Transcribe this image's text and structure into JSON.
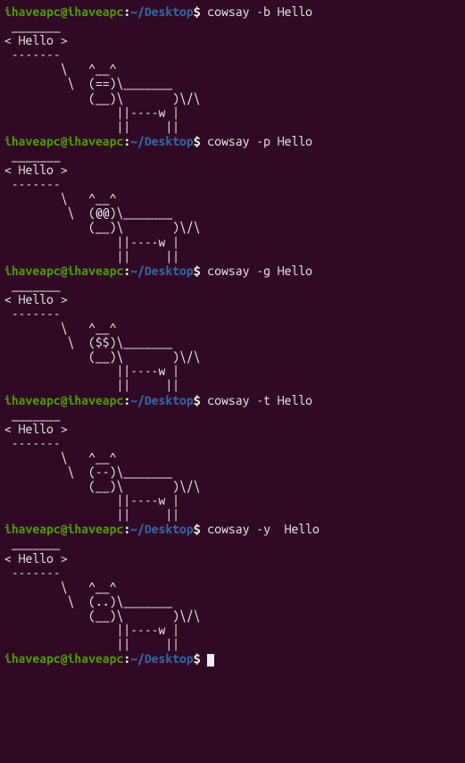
{
  "prompt": {
    "user": "ihaveapc",
    "at": "@",
    "host": "ihaveapc",
    "colon": ":",
    "path": "~/Desktop",
    "dollar": "$"
  },
  "blocks": [
    {
      "cmd": " cowsay -b Hello",
      "output": " _______\n< Hello >\n -------\n        \\   ^__^\n         \\  (==)\\_______\n            (__)\\       )\\/\\\n                ||----w |\n                ||     ||"
    },
    {
      "cmd": " cowsay -p Hello",
      "output": " _______\n< Hello >\n -------\n        \\   ^__^\n         \\  (@@)\\_______\n            (__)\\       )\\/\\\n                ||----w |\n                ||     ||"
    },
    {
      "cmd": " cowsay -g Hello",
      "output": " _______\n< Hello >\n -------\n        \\   ^__^\n         \\  ($$)\\_______\n            (__)\\       )\\/\\\n                ||----w |\n                ||     ||"
    },
    {
      "cmd": " cowsay -t Hello",
      "output": " _______\n< Hello >\n -------\n        \\   ^__^\n         \\  (--)\\_______\n            (__)\\       )\\/\\\n                ||----w |\n                ||     ||"
    },
    {
      "cmd": " cowsay -y  Hello",
      "output": " _______\n< Hello >\n -------\n        \\   ^__^\n         \\  (..)\\_______\n            (__)\\       )\\/\\\n                ||----w |\n                ||     ||"
    }
  ],
  "final_cmd": " "
}
